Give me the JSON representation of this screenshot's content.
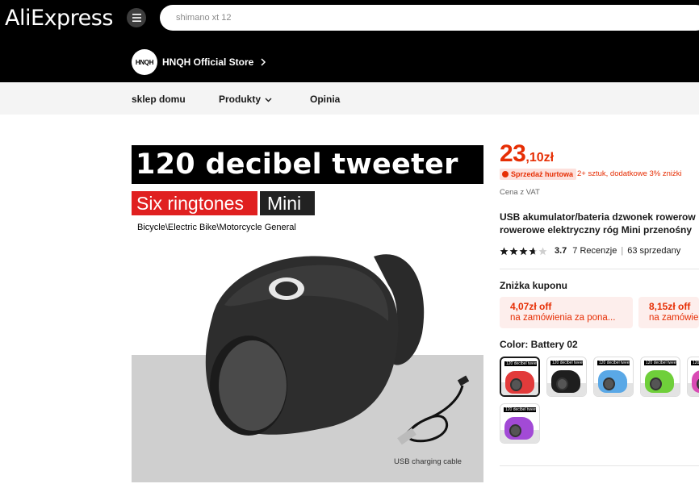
{
  "header": {
    "logo": "AliExpress",
    "search_placeholder": "shimano xt 12"
  },
  "store": {
    "avatar_text": "HNQH",
    "name": "HNQH Official Store"
  },
  "store_nav": {
    "home": "sklep domu",
    "products": "Produkty",
    "feedback": "Opinia"
  },
  "gallery": {
    "headline": "120 decibel tweeter",
    "tag_red": "Six ringtones",
    "tag_dark": "Mini",
    "subtitle": "Bicycle\\Electric Bike\\Motorcycle General",
    "usb_label": "USB charging cable"
  },
  "product": {
    "price_main": "23",
    "price_fraction": ",10zł",
    "wholesale_badge": "Sprzedaż hurtowa",
    "wholesale_note": "2+ sztuk, dodatkowe 3% zniżki",
    "vat_note": "Cena z VAT",
    "title_line1": "USB akumulator/bateria dzwonek rowerow",
    "title_line2": "rowerowe elektryczny róg Mini przenośny",
    "rating": 3.7,
    "rating_text": "3.7",
    "reviews": "7 Recenzje",
    "sold": "63 sprzedany"
  },
  "coupons": {
    "title": "Zniżka kuponu",
    "items": [
      {
        "amount": "4,07zł off",
        "desc": "na zamówienia za pona..."
      },
      {
        "amount": "8,15zł off",
        "desc": "na zamówie"
      }
    ]
  },
  "colors": {
    "title": "Color: Battery 02",
    "selected": "Battery 02",
    "swatch_caption": "120 decibel tweeter",
    "swatches": [
      {
        "color": "#e23b3b"
      },
      {
        "color": "#1e1e1e"
      },
      {
        "color": "#5aa8e6"
      },
      {
        "color": "#6fcf3a"
      },
      {
        "color": "#d94bb4"
      },
      {
        "color": "#a24ad6"
      }
    ]
  }
}
